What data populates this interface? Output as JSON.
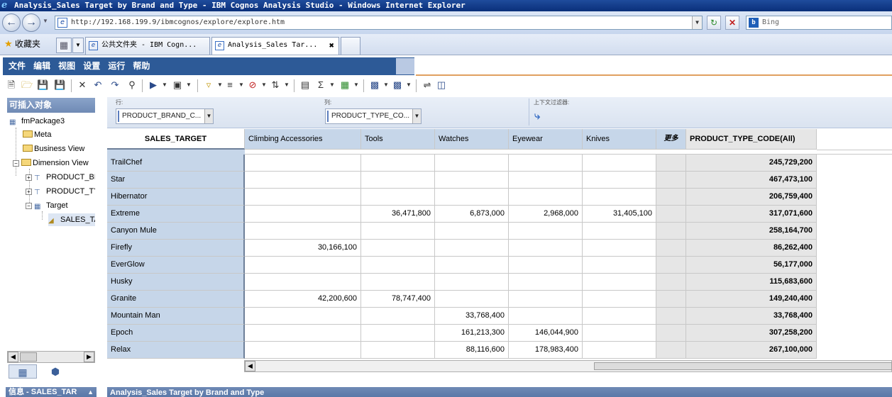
{
  "window": {
    "title": "Analysis_Sales Target by Brand and Type - IBM Cognos Analysis Studio - Windows Internet Explorer"
  },
  "browser": {
    "address": "http://192.168.199.9/ibmcognos/explore/explore.htm",
    "search_placeholder": "Bing",
    "favorites_label": "收藏夹",
    "tabs": [
      {
        "label": "公共文件夹 - IBM Cogn...",
        "active": false
      },
      {
        "label": "Analysis_Sales Tar...",
        "active": true
      }
    ]
  },
  "menu": [
    "文件",
    "编辑",
    "视图",
    "设置",
    "运行",
    "帮助"
  ],
  "left_panel": {
    "title": "可插入对象",
    "tree": {
      "package": "fmPackage3",
      "meta": "Meta",
      "business_view": "Business View",
      "dimension_view": "Dimension View",
      "product_brand": "PRODUCT_BR",
      "product_type": "PRODUCT_TY",
      "target": "Target",
      "sales_target": "SALES_TA"
    },
    "info_title": "信息 - SALES_TAR"
  },
  "overview": {
    "rows_label": "行:",
    "rows_value": "PRODUCT_BRAND_C...",
    "cols_label": "列:",
    "cols_value": "PRODUCT_TYPE_CO...",
    "context_label": "上下文过滤器:"
  },
  "crosstab": {
    "corner": "SALES_TARGET",
    "columns": [
      "Climbing Accessories",
      "Tools",
      "Watches",
      "Eyewear",
      "Knives",
      "更多",
      "PRODUCT_TYPE_CODE(All)"
    ],
    "rows": [
      {
        "label": "TrailChef",
        "values": [
          "",
          "",
          "",
          "",
          "",
          "",
          "245,729,200"
        ]
      },
      {
        "label": "Star",
        "values": [
          "",
          "",
          "",
          "",
          "",
          "",
          "467,473,100"
        ]
      },
      {
        "label": "Hibernator",
        "values": [
          "",
          "",
          "",
          "",
          "",
          "",
          "206,759,400"
        ]
      },
      {
        "label": "Extreme",
        "values": [
          "",
          "36,471,800",
          "6,873,000",
          "2,968,000",
          "31,405,100",
          "",
          "317,071,600"
        ]
      },
      {
        "label": "Canyon Mule",
        "values": [
          "",
          "",
          "",
          "",
          "",
          "",
          "258,164,700"
        ]
      },
      {
        "label": "Firefly",
        "values": [
          "30,166,100",
          "",
          "",
          "",
          "",
          "",
          "86,262,400"
        ]
      },
      {
        "label": "EverGlow",
        "values": [
          "",
          "",
          "",
          "",
          "",
          "",
          "56,177,000"
        ]
      },
      {
        "label": "Husky",
        "values": [
          "",
          "",
          "",
          "",
          "",
          "",
          "115,683,600"
        ]
      },
      {
        "label": "Granite",
        "values": [
          "42,200,600",
          "78,747,400",
          "",
          "",
          "",
          "",
          "149,240,400"
        ]
      },
      {
        "label": "Mountain Man",
        "values": [
          "",
          "",
          "33,768,400",
          "",
          "",
          "",
          "33,768,400"
        ]
      },
      {
        "label": "Epoch",
        "values": [
          "",
          "",
          "161,213,300",
          "146,044,900",
          "",
          "",
          "307,258,200"
        ]
      },
      {
        "label": "Relax",
        "values": [
          "",
          "",
          "88,116,600",
          "178,983,400",
          "",
          "",
          "267,100,000"
        ]
      }
    ]
  },
  "bottom_title": "Analysis_Sales Target by Brand and Type"
}
